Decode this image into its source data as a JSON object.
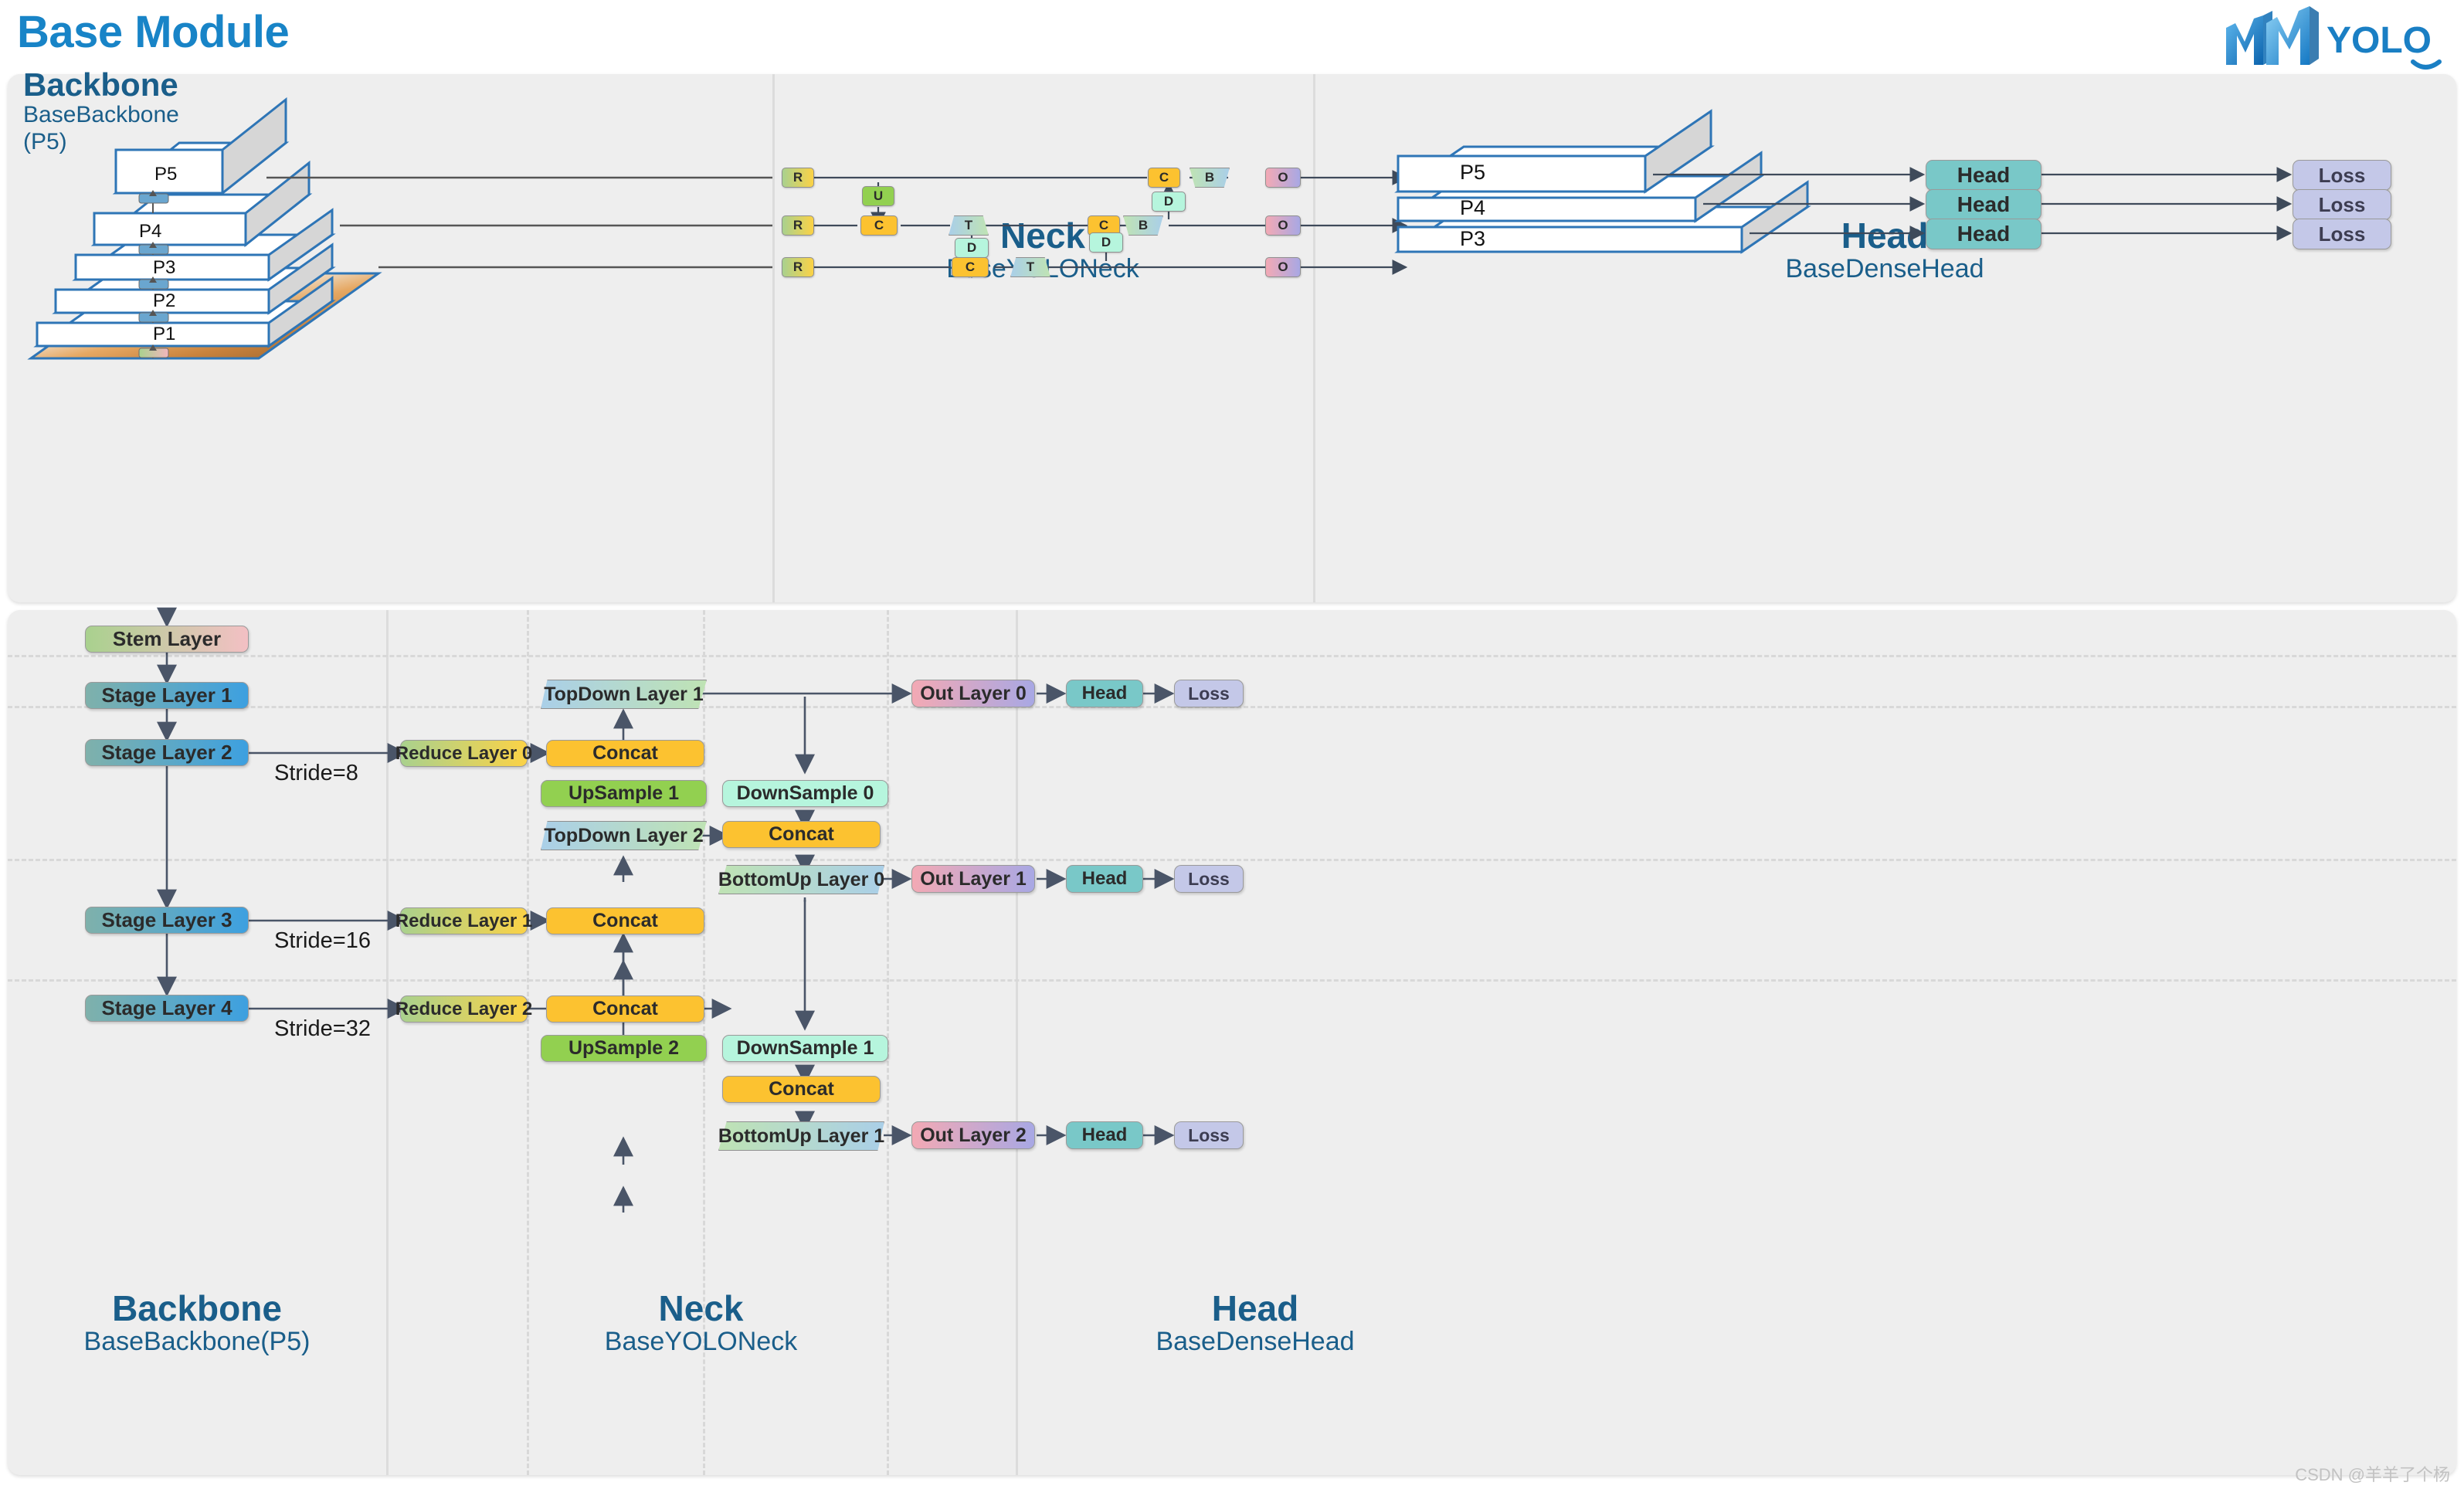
{
  "page": {
    "title": "Base Module",
    "logo_text": "YOLO",
    "watermark": "CSDN @羊羊了个杨",
    "accent": "#1884c7",
    "heading_color": "#1a5e8a"
  },
  "top_panel": {
    "backbone": {
      "title": "Backbone",
      "subtitle_line1": "BaseBackbone",
      "subtitle_line2": "(P5)"
    },
    "neck": {
      "title": "Neck",
      "subtitle": "BaseYOLONeck"
    },
    "head": {
      "title": "Head",
      "subtitle": "BaseDenseHead"
    },
    "pyramid_levels": [
      "P5",
      "P4",
      "P3",
      "P2",
      "P1"
    ],
    "head_levels": [
      "P5",
      "P4",
      "P3"
    ],
    "mini_nodes": {
      "reduce": "R",
      "concat": "C",
      "upsample": "U",
      "downsample": "D",
      "topdown": "T",
      "bottomup": "B",
      "out": "O"
    },
    "head_boxes": [
      "Head",
      "Head",
      "Head"
    ],
    "loss_boxes": [
      "Loss",
      "Loss",
      "Loss"
    ]
  },
  "bottom_panel": {
    "backbone": {
      "title": "Backbone",
      "subtitle": "BaseBackbone(P5)"
    },
    "neck": {
      "title": "Neck",
      "subtitle": "BaseYOLONeck"
    },
    "head": {
      "title": "Head",
      "subtitle": "BaseDenseHead"
    },
    "backbone_nodes": [
      "Stem Layer",
      "Stage Layer 1",
      "Stage Layer 2",
      "Stage Layer 3",
      "Stage Layer 4"
    ],
    "strides": [
      "Stride=8",
      "Stride=16",
      "Stride=32"
    ],
    "reduce_layers": [
      "Reduce Layer 0",
      "Reduce Layer 1",
      "Reduce Layer 2"
    ],
    "concat_topdown": [
      "Concat",
      "Concat",
      "Concat"
    ],
    "topdown_layers": [
      "TopDown Layer 1",
      "TopDown Layer 2"
    ],
    "upsample_layers": [
      "UpSample 1",
      "UpSample 2"
    ],
    "downsample_layers": [
      "DownSample 0",
      "DownSample 1"
    ],
    "concat_bottomup": [
      "Concat",
      "Concat"
    ],
    "bottomup_layers": [
      "BottomUp Layer 0",
      "BottomUp Layer 1"
    ],
    "out_layers": [
      "Out Layer 0",
      "Out Layer 1",
      "Out Layer 2"
    ],
    "heads": [
      "Head",
      "Head",
      "Head"
    ],
    "losses": [
      "Loss",
      "Loss",
      "Loss"
    ]
  },
  "colors": {
    "panel_bg": "#eeeeee",
    "stem": "#a9d18e",
    "stage": "#3da0e0",
    "reduce": "#fbd246",
    "concat": "#fcc230",
    "upsample": "#92d050",
    "downsample": "#b6f5dd",
    "topdown": "#aacfe8",
    "bottomup": "#bfe3b4",
    "out": "#f3a9b4",
    "head": "#79c8c8",
    "loss": "#c4c8e8",
    "pyramid_edge": "#2e75b6"
  }
}
